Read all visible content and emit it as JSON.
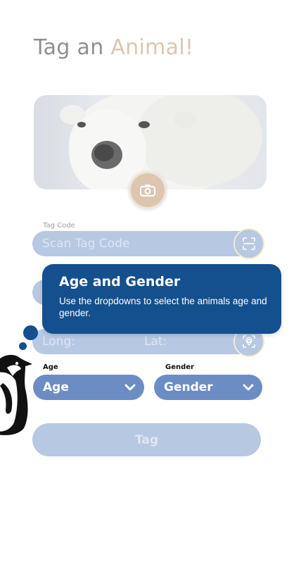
{
  "header": {
    "title_part1": "Tag an",
    "title_part2": "Animal!"
  },
  "colors": {
    "accent_blue": "#14508d",
    "field_blue": "#b7c8e2",
    "dropdown_blue": "#6b8dc3",
    "beige": "#d9c7b3"
  },
  "photo": {
    "icon": "camera-icon"
  },
  "tag_code": {
    "label": "Tag Code",
    "placeholder": "Scan Tag Code",
    "icon": "scan-icon"
  },
  "location": {
    "long_placeholder": "Long:",
    "lat_placeholder": "Lat:",
    "icon": "location-scan-icon"
  },
  "age": {
    "label": "Age",
    "selected": "Age",
    "icon": "chevron-down-icon"
  },
  "gender": {
    "label": "Gender",
    "selected": "Gender",
    "icon": "chevron-down-icon"
  },
  "submit": {
    "label": "Tag"
  },
  "tooltip": {
    "title": "Age and Gender",
    "body": "Use the dropdowns to select the animals age and gender."
  },
  "mascot": {
    "icon": "penguin-icon"
  }
}
